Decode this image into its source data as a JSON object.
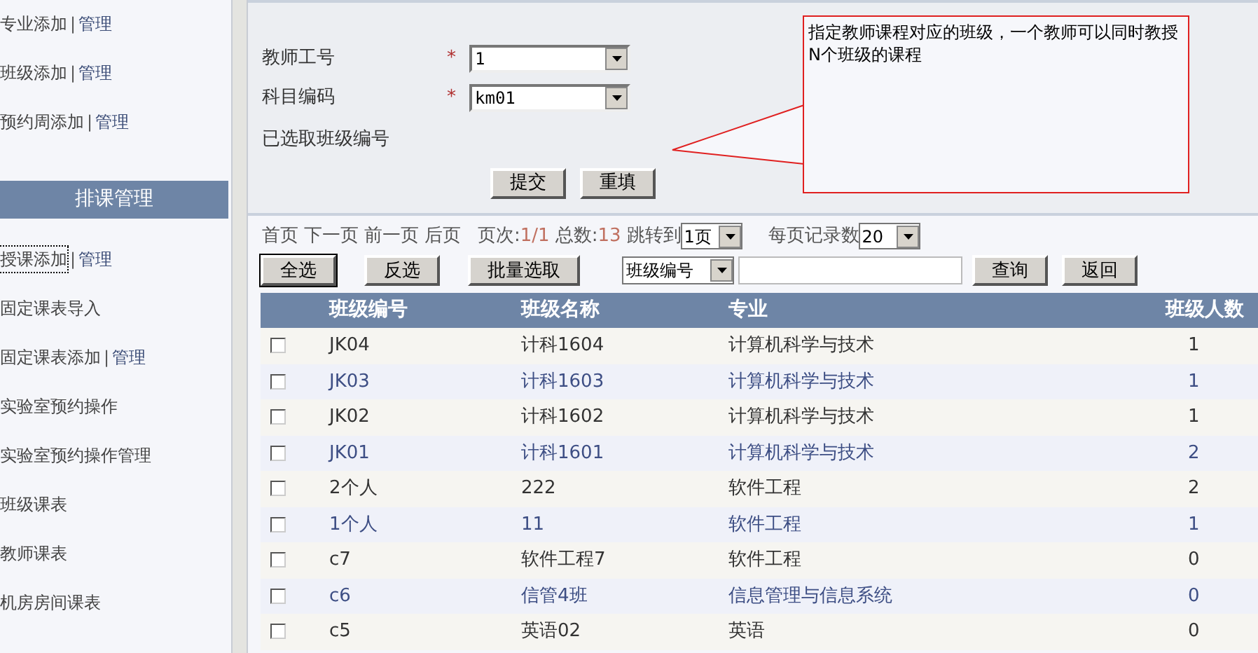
{
  "sidebar": [
    {
      "kind": "link",
      "label": "专业添加",
      "separator": "|",
      "manage": "管理",
      "focused": false
    },
    {
      "kind": "link",
      "label": "班级添加",
      "separator": "|",
      "manage": "管理",
      "focused": false
    },
    {
      "kind": "link",
      "label": "预约周添加",
      "separator": "|",
      "manage": "管理",
      "focused": false
    },
    {
      "kind": "header",
      "label": "排课管理"
    },
    {
      "kind": "link",
      "label": "授课添加",
      "separator": "|",
      "manage": "管理",
      "focused": true
    },
    {
      "kind": "link",
      "label": "固定课表导入",
      "focused": false
    },
    {
      "kind": "link",
      "label": "固定课表添加",
      "separator": "|",
      "manage": "管理",
      "focused": false
    },
    {
      "kind": "link",
      "label": "实验室预约操作",
      "focused": false
    },
    {
      "kind": "link",
      "label": "实验室预约操作管理",
      "focused": false
    },
    {
      "kind": "link",
      "label": "班级课表",
      "focused": false
    },
    {
      "kind": "link",
      "label": "教师课表",
      "focused": false
    },
    {
      "kind": "link",
      "label": "机房房间课表",
      "focused": false
    }
  ],
  "form": {
    "fields": [
      {
        "label": "教师工号",
        "required_mark": "*",
        "value": "1"
      },
      {
        "label": "科目编码",
        "required_mark": "*",
        "value": "km01"
      }
    ],
    "selected_label": "已选取班级编号",
    "buttons": [
      "提交",
      "重填"
    ],
    "callout": "指定教师课程对应的班级，一个教师可以同时教授N个班级的课程"
  },
  "pager": {
    "links": [
      "首页",
      "下一页",
      "前一页",
      "后页"
    ],
    "page_label": "页次:",
    "page_value": "1/1",
    "total_label": "总数:",
    "total_value": "13",
    "jump_label": "跳转到",
    "jump_value": "1页",
    "per_page_label": "每页记录数",
    "per_page_value": "20"
  },
  "toolbar": {
    "buttons": [
      {
        "label": "全选",
        "focused": true
      },
      {
        "label": "反选",
        "focused": false
      },
      {
        "label": "批量选取",
        "focused": false
      }
    ],
    "search_by": "班级编号",
    "actions": [
      "查询",
      "返回"
    ]
  },
  "table": {
    "columns": [
      "班级编号",
      "班级名称",
      "专业",
      "班级人数"
    ],
    "rows": [
      {
        "checked": false,
        "cells": [
          "JK04",
          "计科1604",
          "计算机科学与技术",
          "1"
        ]
      },
      {
        "checked": false,
        "cells": [
          "JK03",
          "计科1603",
          "计算机科学与技术",
          "1"
        ]
      },
      {
        "checked": false,
        "cells": [
          "JK02",
          "计科1602",
          "计算机科学与技术",
          "1"
        ]
      },
      {
        "checked": false,
        "cells": [
          "JK01",
          "计科1601",
          "计算机科学与技术",
          "2"
        ]
      },
      {
        "checked": false,
        "cells": [
          "2个人",
          "222",
          "软件工程",
          "2"
        ]
      },
      {
        "checked": false,
        "cells": [
          "1个人",
          "11",
          "软件工程",
          "1"
        ]
      },
      {
        "checked": false,
        "cells": [
          "c7",
          "软件工程7",
          "软件工程",
          "0"
        ]
      },
      {
        "checked": false,
        "cells": [
          "c6",
          "信管4班",
          "信息管理与信息系统",
          "0"
        ]
      },
      {
        "checked": false,
        "cells": [
          "c5",
          "英语02",
          "英语",
          "0"
        ]
      }
    ]
  }
}
